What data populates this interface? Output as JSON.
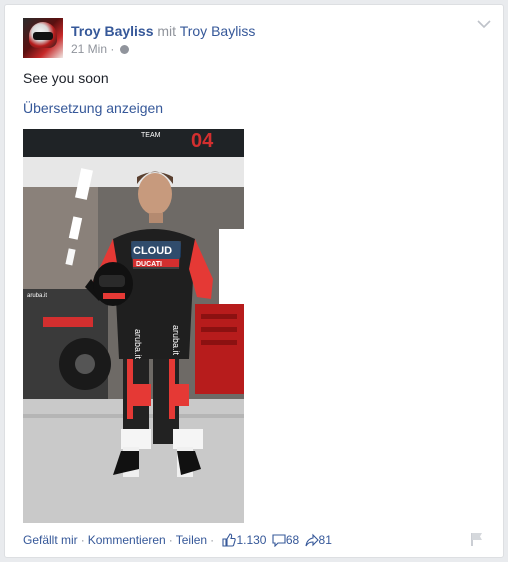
{
  "post": {
    "author": "Troy Bayliss",
    "with_word": "mit",
    "with_name": "Troy Bayliss",
    "time": "21 Min",
    "dot": "·",
    "text": "See you soon",
    "translate_link": "Übersetzung anzeigen",
    "photo_texts": {
      "team": "TEAM",
      "number": "04",
      "cloud": "CLOUD",
      "ducati": "DUCATI",
      "aruba": "aruba.it"
    }
  },
  "actions": {
    "like": "Gefällt mir",
    "comment": "Kommentieren",
    "share": "Teilen",
    "separator": "·",
    "likes_count": "1.130",
    "comments_count": "68",
    "shares_count": "81"
  },
  "icons": {
    "avatar": "avatar-photo",
    "menu": "chevron-down-icon",
    "privacy": "globe-icon",
    "like": "thumbs-up-icon",
    "comment": "comment-bubble-icon",
    "share": "share-arrow-icon",
    "report": "flag-icon"
  },
  "colors": {
    "link": "#365899",
    "muted": "#90949c",
    "text": "#1d2129",
    "ducati_red": "#c62828"
  }
}
